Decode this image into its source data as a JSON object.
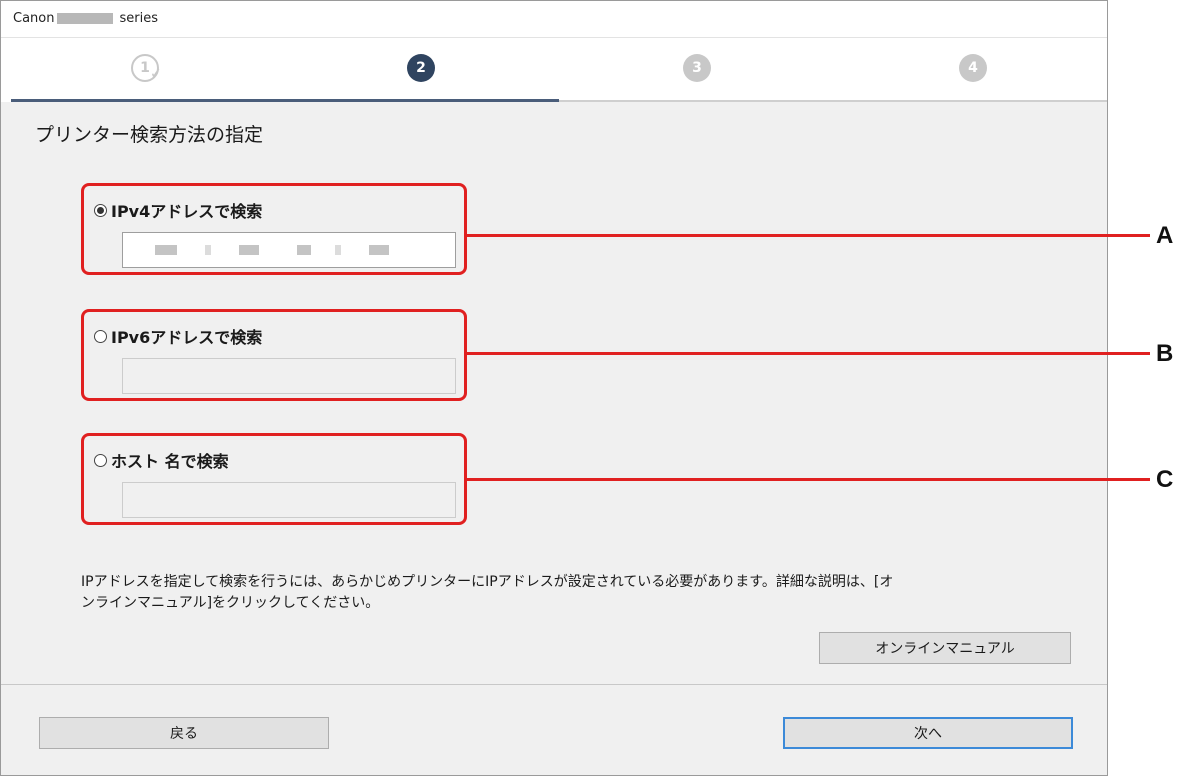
{
  "window": {
    "title_prefix": "Canon",
    "title_suffix": "series"
  },
  "steps": [
    {
      "label": "1",
      "state": "done"
    },
    {
      "label": "2",
      "state": "active"
    },
    {
      "label": "3",
      "state": "future"
    },
    {
      "label": "4",
      "state": "future"
    }
  ],
  "page": {
    "heading": "プリンター検索方法の指定"
  },
  "options": [
    {
      "label": "IPv4アドレスで検索",
      "selected": true,
      "field_value": "",
      "enabled": true,
      "callout": "A"
    },
    {
      "label": "IPv6アドレスで検索",
      "selected": false,
      "field_value": "",
      "enabled": false,
      "callout": "B"
    },
    {
      "label": "ホスト 名で検索",
      "selected": false,
      "field_value": "",
      "enabled": false,
      "callout": "C"
    }
  ],
  "info_text_line1": "IPアドレスを指定して検索を行うには、あらかじめプリンターにIPアドレスが設定されている必要があります。詳細な説明は、[オ",
  "info_text_line2": "ンラインマニュアル]をクリックしてください。",
  "buttons": {
    "online_manual": "オンラインマニュアル",
    "back": "戻る",
    "next": "次へ"
  },
  "colors": {
    "callout_red": "#e02020",
    "active_step": "#2f4460",
    "inactive_step": "#c8c8c8",
    "primary_border": "#3c8ad8"
  },
  "icons": [
    "step-1-check-icon",
    "step-2-icon",
    "step-3-icon",
    "step-4-icon",
    "radio-icon"
  ]
}
